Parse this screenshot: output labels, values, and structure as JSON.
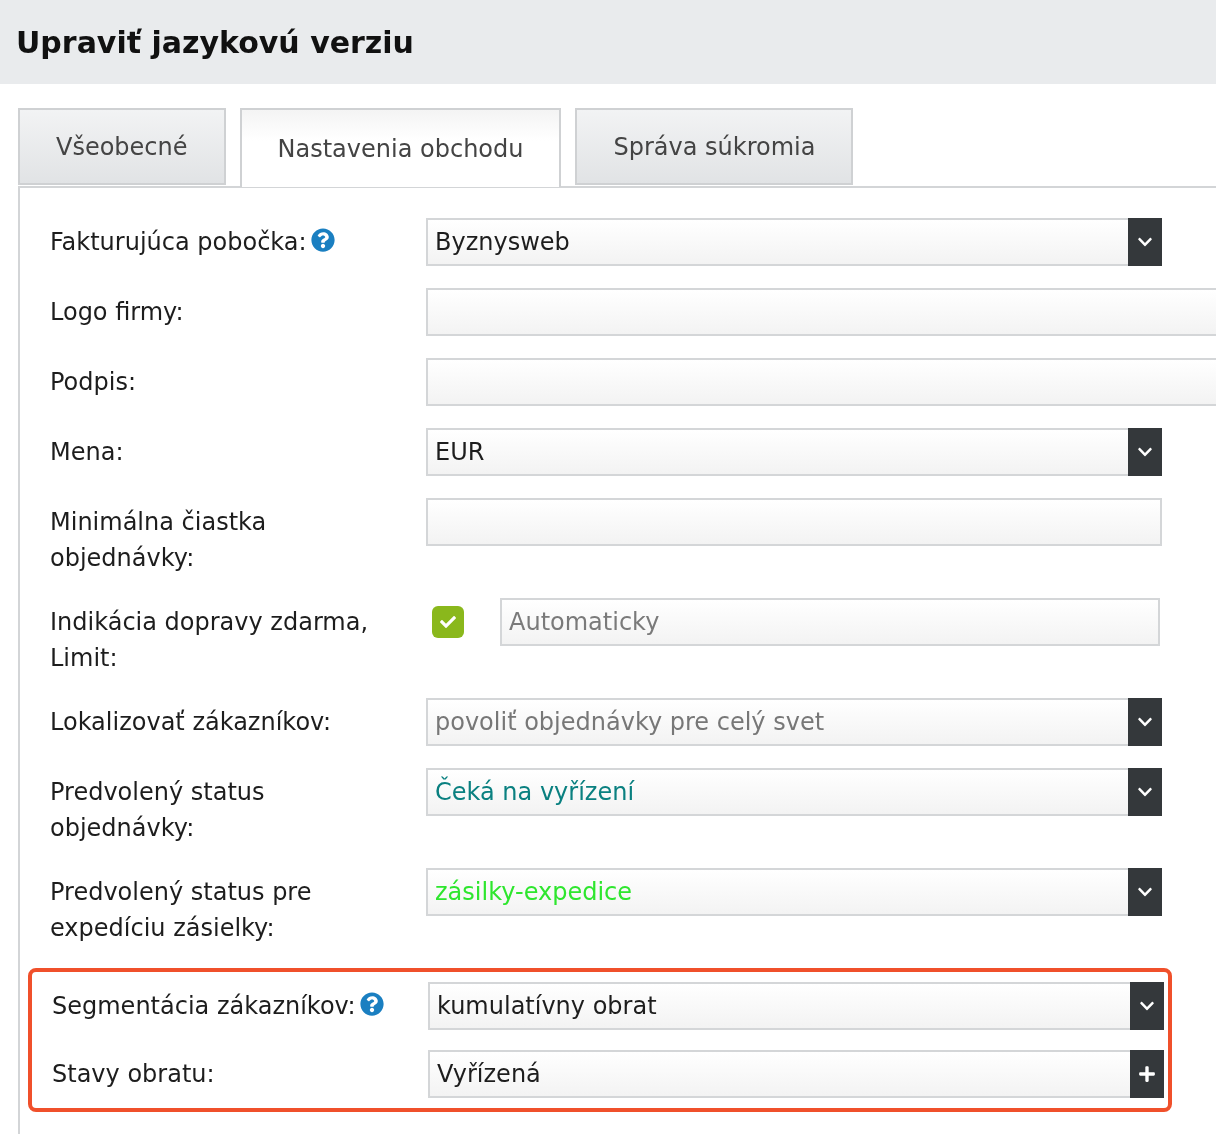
{
  "header": {
    "title": "Upraviť jazykovú verziu"
  },
  "tabs": [
    {
      "label": "Všeobecné",
      "selected": false
    },
    {
      "label": "Nastavenia obchodu",
      "selected": true
    },
    {
      "label": "Správa súkromia",
      "selected": false
    }
  ],
  "fields": [
    {
      "kind": "select",
      "label": "Fakturujúca pobočka:",
      "help": true,
      "value": "Byznysweb",
      "disabled": false,
      "highlighted": false
    },
    {
      "kind": "text",
      "label": "Logo firmy:",
      "help": false,
      "highlighted": false
    },
    {
      "kind": "text",
      "label": "Podpis:",
      "help": false,
      "highlighted": false
    },
    {
      "kind": "select",
      "label": "Mena:",
      "help": false,
      "value": "EUR",
      "disabled": false,
      "highlighted": false
    },
    {
      "kind": "short-text",
      "label": "Minimálna čiastka objednávky:",
      "help": false,
      "highlighted": false
    },
    {
      "kind": "checkbox-text",
      "label": "Indikácia dopravy zdarma, Limit:",
      "help": false,
      "checked": true,
      "placeholder": "Automaticky",
      "highlighted": false
    },
    {
      "kind": "select",
      "label": "Lokalizovať zákazníkov:",
      "help": false,
      "value": "povoliť objednávky pre celý svet",
      "disabled": true,
      "highlighted": false
    },
    {
      "kind": "select",
      "label": "Predvolený status objednávky:",
      "help": false,
      "value": "Čeká na vyřízení",
      "color": "#0a8080",
      "disabled": false,
      "highlighted": false
    },
    {
      "kind": "select",
      "label": "Predvolený status pre expedíciu zásielky:",
      "help": false,
      "value": "zásilky-expedice",
      "color": "#2ee62e",
      "disabled": false,
      "highlighted": false
    },
    {
      "kind": "select",
      "label": "Segmentácia zákazníkov:",
      "help": true,
      "value": "kumulatívny obrat",
      "disabled": false,
      "highlighted": true
    },
    {
      "kind": "multi-add",
      "label": "Stavy obratu:",
      "help": false,
      "value": "Vyřízená",
      "highlighted": true
    }
  ]
}
